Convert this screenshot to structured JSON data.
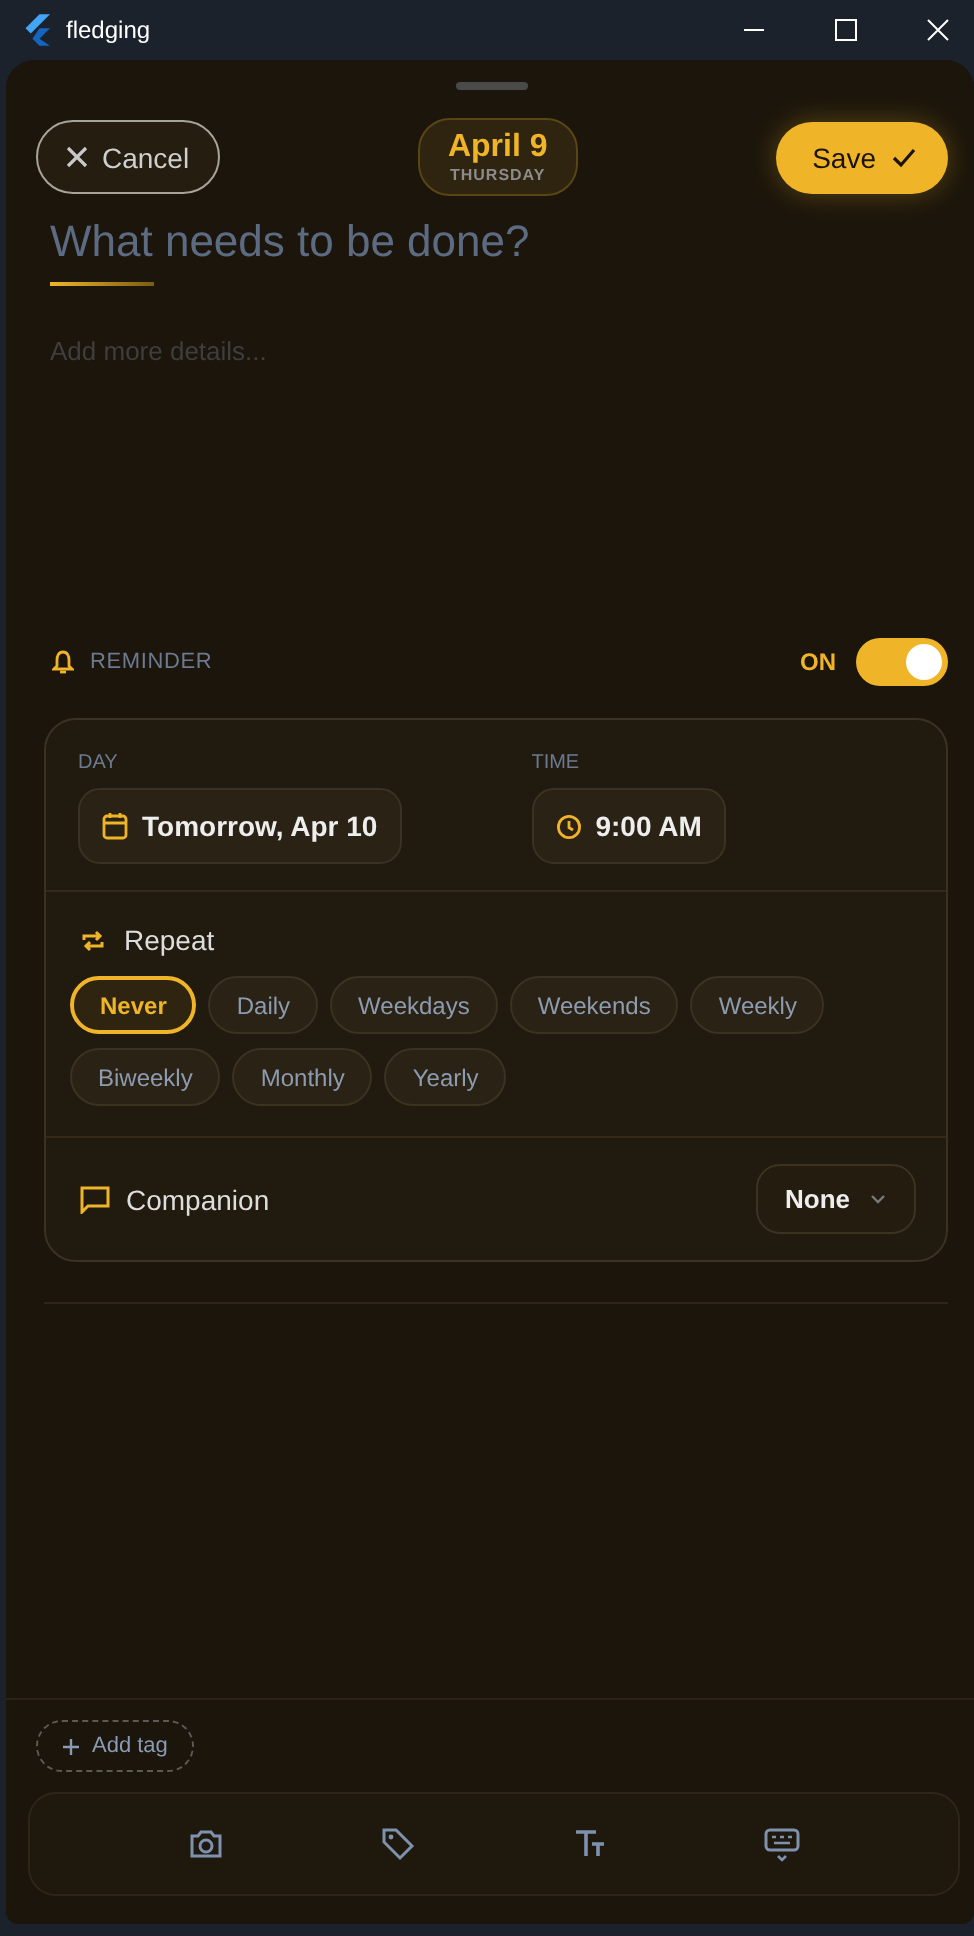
{
  "window": {
    "title": "fledging"
  },
  "header": {
    "cancel": "Cancel",
    "date": "April 9",
    "weekday": "THURSDAY",
    "save": "Save"
  },
  "title_field": {
    "placeholder": "What needs to be done?"
  },
  "details_field": {
    "placeholder": "Add more details..."
  },
  "reminder": {
    "label": "REMINDER",
    "state": "ON",
    "on": true
  },
  "day": {
    "label": "DAY",
    "value": "Tomorrow, Apr 10"
  },
  "time": {
    "label": "TIME",
    "value": "9:00 AM"
  },
  "repeat": {
    "label": "Repeat",
    "options": [
      {
        "label": "Never",
        "selected": true
      },
      {
        "label": "Daily",
        "selected": false
      },
      {
        "label": "Weekdays",
        "selected": false
      },
      {
        "label": "Weekends",
        "selected": false
      },
      {
        "label": "Weekly",
        "selected": false
      },
      {
        "label": "Biweekly",
        "selected": false
      },
      {
        "label": "Monthly",
        "selected": false
      },
      {
        "label": "Yearly",
        "selected": false
      }
    ]
  },
  "companion": {
    "label": "Companion",
    "value": "None"
  },
  "add_tag": "Add tag",
  "toolbar": [
    {
      "kind": "camera"
    },
    {
      "kind": "tag"
    },
    {
      "kind": "format"
    },
    {
      "kind": "keyboard"
    }
  ]
}
